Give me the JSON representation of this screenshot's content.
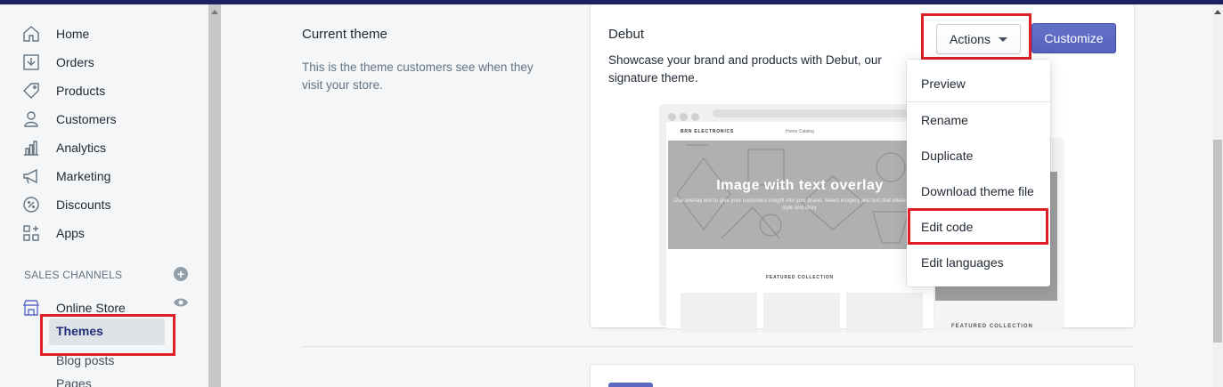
{
  "sidebar": {
    "items": [
      {
        "label": "Home",
        "icon": "home-icon"
      },
      {
        "label": "Orders",
        "icon": "orders-icon"
      },
      {
        "label": "Products",
        "icon": "tag-icon"
      },
      {
        "label": "Customers",
        "icon": "person-icon"
      },
      {
        "label": "Analytics",
        "icon": "bar-chart-icon"
      },
      {
        "label": "Marketing",
        "icon": "megaphone-icon"
      },
      {
        "label": "Discounts",
        "icon": "discount-icon"
      },
      {
        "label": "Apps",
        "icon": "apps-icon"
      }
    ],
    "sales_channels_heading": "SALES CHANNELS",
    "online_store_label": "Online Store",
    "sub_items": [
      "Themes",
      "Blog posts",
      "Pages"
    ]
  },
  "current_theme": {
    "title": "Current theme",
    "description": "This is the theme customers see when they visit your store."
  },
  "theme_card": {
    "name": "Debut",
    "description": "Showcase your brand and products with Debut, our signature theme.",
    "actions_label": "Actions",
    "customize_label": "Customize"
  },
  "actions_menu": [
    "Preview",
    "Rename",
    "Duplicate",
    "Download theme file",
    "Edit code",
    "Edit languages"
  ],
  "preview": {
    "brand": "BRN ELECTRONICS",
    "nav": "Home   Catalog",
    "hero_title": "Image with text overlay",
    "hero_sub": "Use overlay text to give your customers insight into your brand. Select imagery and text that relates to your style and story.",
    "featured": "FEATURED COLLECTION",
    "featured_back": "FEATURED COLLECTION"
  },
  "colors": {
    "accent": "#5c6ac4",
    "highlight": "#e01e26",
    "topbar": "#1c2260"
  }
}
